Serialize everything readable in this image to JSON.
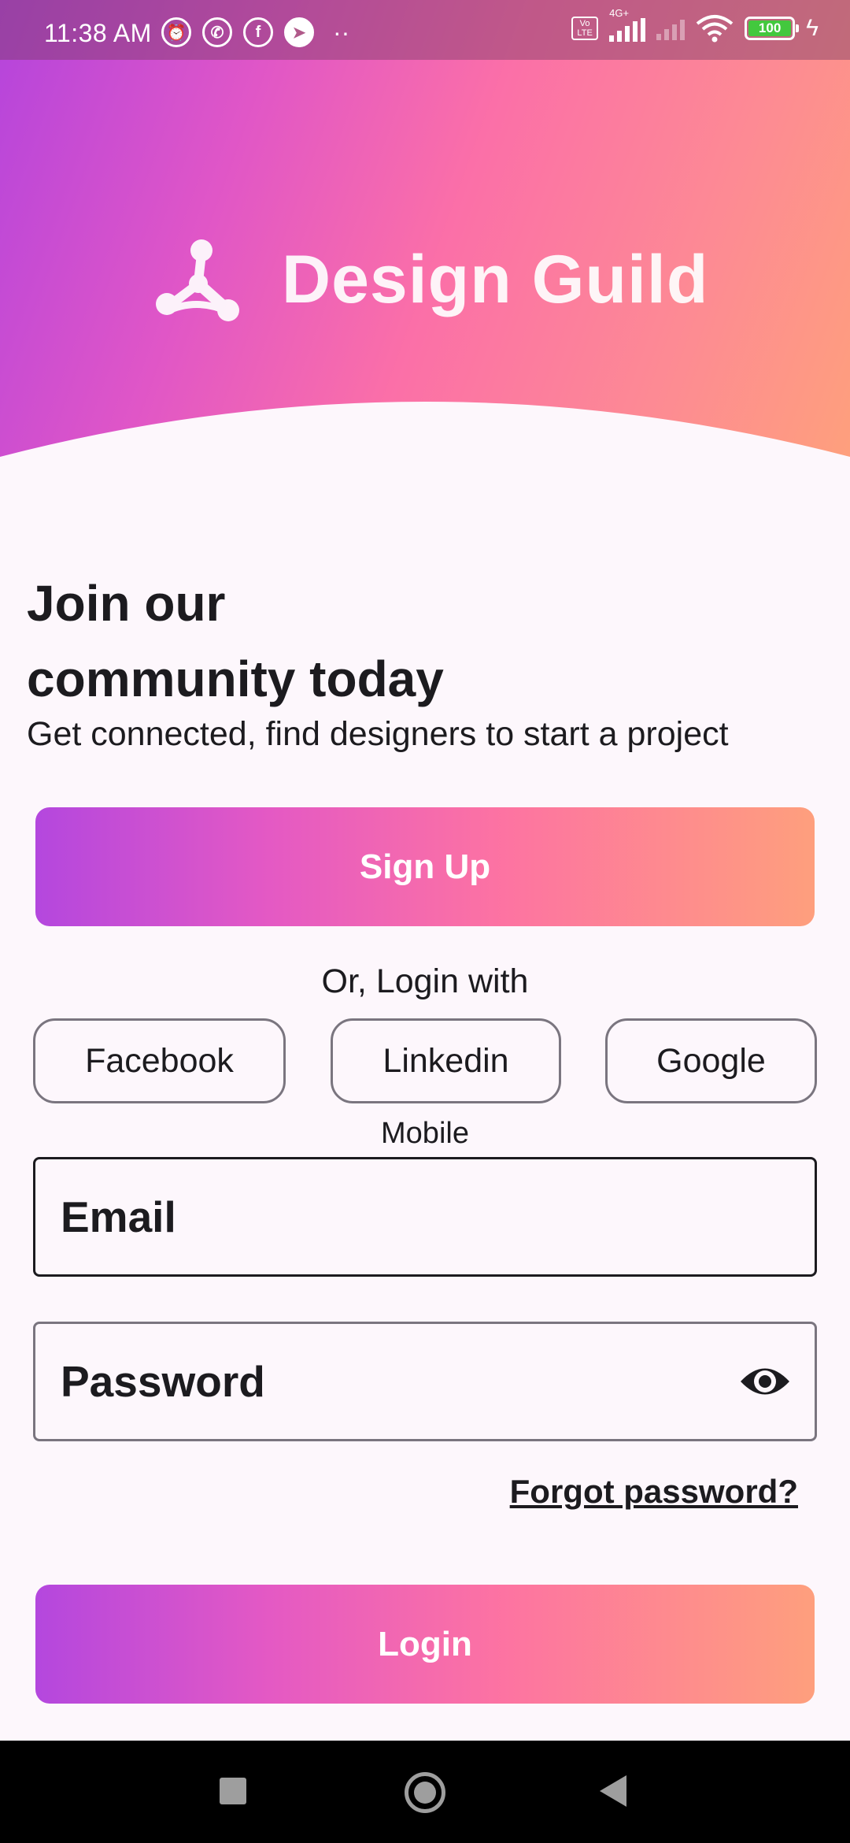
{
  "status_bar": {
    "time": "11:38 AM",
    "battery": "100",
    "network": "4G+",
    "volte": "Vo LTE"
  },
  "brand": {
    "name": "Design Guild",
    "logo_icon": "network-nodes-icon"
  },
  "intro": {
    "headline_line1": "Join our",
    "headline_line2": "community today",
    "subtitle": "Get connected, find designers to start a project"
  },
  "actions": {
    "signup_label": "Sign Up",
    "or_login_with": "Or, Login with",
    "social": [
      "Facebook",
      "Linkedin",
      "Google"
    ],
    "mobile_label": "Mobile",
    "forgot_password": "Forgot password?",
    "login_label": "Login"
  },
  "form": {
    "email_placeholder": "Email",
    "password_placeholder": "Password"
  },
  "colors": {
    "gradient_start": "#b447de",
    "gradient_mid": "#fd73a2",
    "gradient_end": "#fe9f7d",
    "background": "#fdf7fc",
    "text": "#1c1b1f"
  }
}
